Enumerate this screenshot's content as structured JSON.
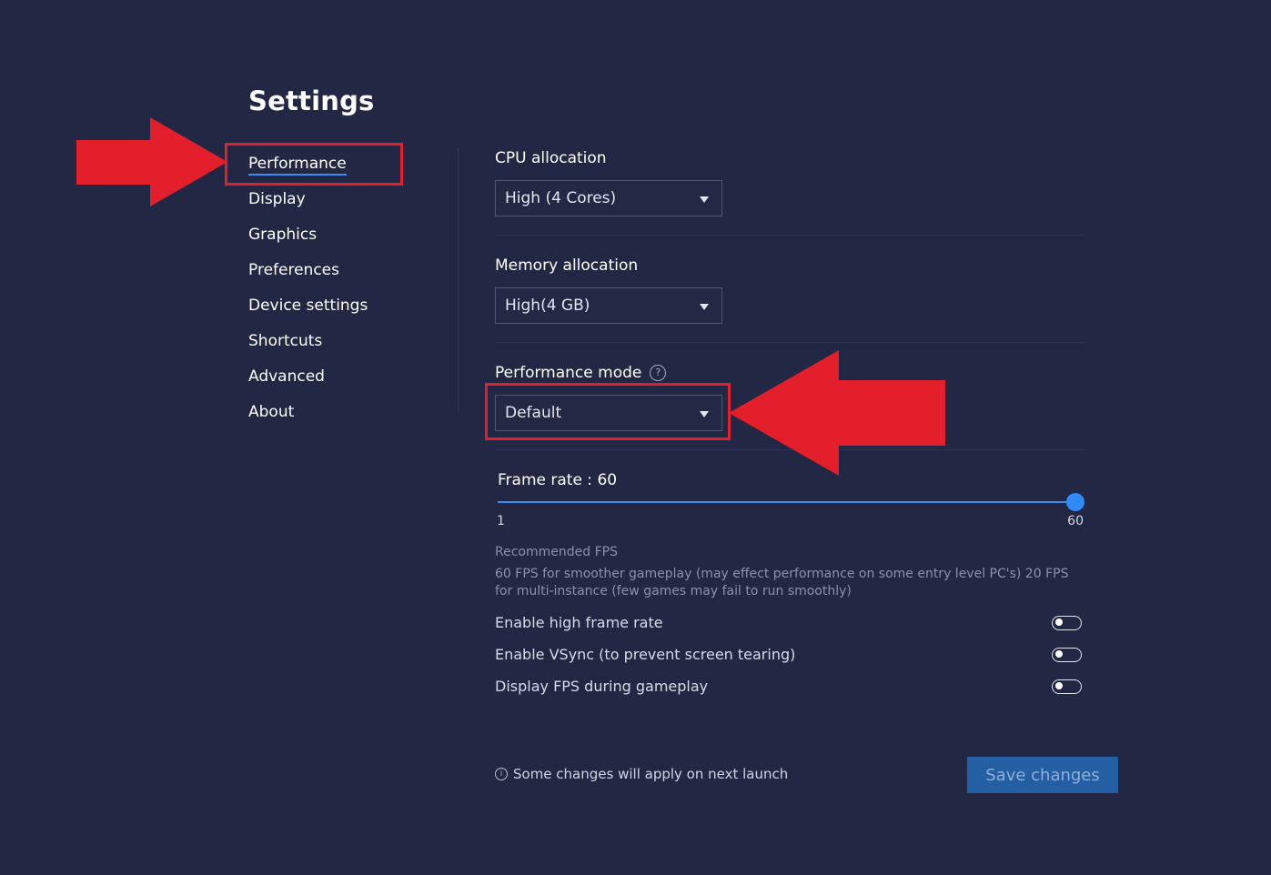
{
  "title": "Settings",
  "sidebar": {
    "items": [
      {
        "label": "Performance",
        "active": true
      },
      {
        "label": "Display"
      },
      {
        "label": "Graphics"
      },
      {
        "label": "Preferences"
      },
      {
        "label": "Device settings"
      },
      {
        "label": "Shortcuts"
      },
      {
        "label": "Advanced"
      },
      {
        "label": "About"
      }
    ]
  },
  "cpu": {
    "label": "CPU allocation",
    "value": "High (4 Cores)"
  },
  "memory": {
    "label": "Memory allocation",
    "value": "High(4 GB)"
  },
  "performance_mode": {
    "label": "Performance mode",
    "help_glyph": "?",
    "value": "Default"
  },
  "frame_rate": {
    "label": "Frame rate : 60",
    "min_label": "1",
    "max_label": "60",
    "value": 60,
    "min": 1,
    "max": 60
  },
  "recommended": {
    "title": "Recommended FPS",
    "description": "60 FPS for smoother gameplay (may effect performance on some entry level PC's) 20 FPS for multi-instance (few games may fail to run smoothly)"
  },
  "toggles": [
    {
      "label": "Enable high frame rate",
      "on": false
    },
    {
      "label": "Enable VSync (to prevent screen tearing)",
      "on": false
    },
    {
      "label": "Display FPS during gameplay",
      "on": false
    }
  ],
  "footer": {
    "info_glyph": "i",
    "note": "Some changes will apply on next launch",
    "save_label": "Save changes"
  },
  "colors": {
    "background": "#222744",
    "accent": "#3d8cf2",
    "annotation": "#e21f2b",
    "button": "#245ea3"
  }
}
